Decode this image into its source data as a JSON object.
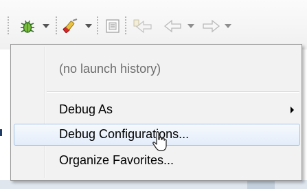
{
  "toolbar": {
    "icons": [
      "debug-bug-icon",
      "external-tools-icon",
      "toggle-view-icon",
      "last-edit-location-icon",
      "back-icon",
      "forward-icon"
    ]
  },
  "menu": {
    "items": [
      {
        "label": "(no launch history)",
        "enabled": false
      },
      {
        "label": "Debug As",
        "has_submenu": true
      },
      {
        "label": "Debug Configurations...",
        "highlighted": true
      },
      {
        "label": "Organize Favorites..."
      }
    ]
  },
  "colors": {
    "menu_background": "#f2f2f2",
    "highlight_border": "#a4c2e6",
    "highlight_fill": "#e3edfa",
    "disabled_text": "#6d6d6d"
  }
}
